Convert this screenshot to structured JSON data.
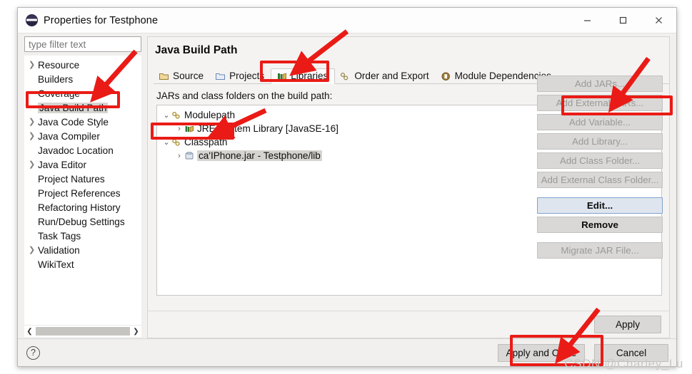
{
  "window": {
    "title": "Properties for Testphone",
    "app_icon": "eclipse-icon",
    "minimize_label": "–",
    "maximize_label": "□",
    "close_label": "✕"
  },
  "toolbar": {
    "back_icon": "back-arrow-icon",
    "back_caret": "chevron-down-icon",
    "forward_icon": "forward-arrow-icon",
    "forward_caret": "chevron-down-icon",
    "menu_icon": "vertical-dots-icon"
  },
  "sidebar": {
    "filter_placeholder": "type filter text",
    "filter_value": "",
    "selected": "Java Build Path",
    "items": [
      {
        "label": "Resource",
        "expandable": true
      },
      {
        "label": "Builders",
        "expandable": false
      },
      {
        "label": "Coverage",
        "expandable": false
      },
      {
        "label": "Java Build Path",
        "expandable": false
      },
      {
        "label": "Java Code Style",
        "expandable": true
      },
      {
        "label": "Java Compiler",
        "expandable": true
      },
      {
        "label": "Javadoc Location",
        "expandable": false
      },
      {
        "label": "Java Editor",
        "expandable": true
      },
      {
        "label": "Project Natures",
        "expandable": false
      },
      {
        "label": "Project References",
        "expandable": false
      },
      {
        "label": "Refactoring History",
        "expandable": false
      },
      {
        "label": "Run/Debug Settings",
        "expandable": false
      },
      {
        "label": "Task Tags",
        "expandable": false
      },
      {
        "label": "Validation",
        "expandable": true
      },
      {
        "label": "WikiText",
        "expandable": false
      }
    ],
    "scroll_left_icon": "chevron-left-icon",
    "scroll_right_icon": "chevron-right-icon"
  },
  "main": {
    "title": "Java Build Path",
    "tabs": [
      {
        "label": "Source",
        "icon": "source-folder-icon",
        "active": false
      },
      {
        "label": "Projects",
        "icon": "projects-folder-icon",
        "active": false
      },
      {
        "label": "Libraries",
        "icon": "libraries-books-icon",
        "active": true
      },
      {
        "label": "Order and Export",
        "icon": "order-export-icon",
        "active": false
      },
      {
        "label": "Module Dependencies",
        "icon": "module-dependencies-icon",
        "active": false
      }
    ],
    "panel_label": "JARs and class folders on the build path:",
    "tree": [
      {
        "label": "Modulepath",
        "icon": "modulepath-icon",
        "arrow": "⌄",
        "depth": 0,
        "selected": false
      },
      {
        "label": "JRE System Library [JavaSE-16]",
        "icon": "jre-library-icon",
        "arrow": "›",
        "depth": 1,
        "selected": false
      },
      {
        "label": "Classpath",
        "icon": "classpath-icon",
        "arrow": "⌄",
        "depth": 0,
        "selected": false
      },
      {
        "label": "ca'IPhone.jar - Testphone/lib",
        "icon": "jar-icon",
        "arrow": "›",
        "depth": 1,
        "selected": true
      }
    ],
    "buttons": [
      {
        "label": "Add JARs...",
        "state": "disabled"
      },
      {
        "label": "Add External JARs...",
        "state": "disabled"
      },
      {
        "label": "Add Variable...",
        "state": "disabled"
      },
      {
        "label": "Add Library...",
        "state": "disabled"
      },
      {
        "label": "Add Class Folder...",
        "state": "disabled"
      },
      {
        "label": "Add External Class Folder...",
        "state": "disabled"
      },
      {
        "label": "Edit...",
        "state": "focused"
      },
      {
        "label": "Remove",
        "state": "enabled"
      },
      {
        "label": "Migrate JAR File...",
        "state": "disabled"
      }
    ],
    "apply_label": "Apply"
  },
  "footer": {
    "help_icon": "question-mark-icon",
    "help_glyph": "?",
    "apply_and_close_label": "Apply and Close",
    "cancel_label": "Cancel"
  },
  "annotations": {
    "accent_color": "#ea1b16",
    "watermark": "CSDN @Charley_Lu"
  }
}
